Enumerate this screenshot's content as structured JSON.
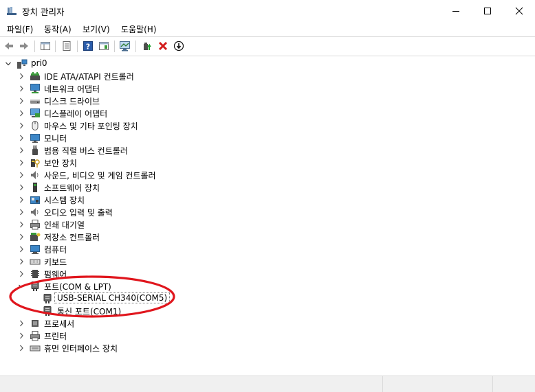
{
  "window": {
    "title": "장치 관리자"
  },
  "menu": [
    {
      "label": "파일(F)"
    },
    {
      "label": "동작(A)"
    },
    {
      "label": "보기(V)"
    },
    {
      "label": "도움말(H)"
    }
  ],
  "tree": {
    "root": {
      "label": "pri0"
    },
    "items": [
      {
        "label": "IDE ATA/ATAPI 컨트롤러",
        "icon": "ide-controller-icon"
      },
      {
        "label": "네트워크 어댑터",
        "icon": "network-adapter-icon"
      },
      {
        "label": "디스크 드라이브",
        "icon": "disk-drive-icon"
      },
      {
        "label": "디스플레이 어댑터",
        "icon": "display-adapter-icon"
      },
      {
        "label": "마우스 및 기타 포인팅 장치",
        "icon": "mouse-icon"
      },
      {
        "label": "모니터",
        "icon": "monitor-icon"
      },
      {
        "label": "범용 직렬 버스 컨트롤러",
        "icon": "usb-icon"
      },
      {
        "label": "보안 장치",
        "icon": "security-device-icon"
      },
      {
        "label": "사운드, 비디오 및 게임 컨트롤러",
        "icon": "speaker-icon"
      },
      {
        "label": "소프트웨어 장치",
        "icon": "software-device-icon"
      },
      {
        "label": "시스템 장치",
        "icon": "system-device-icon"
      },
      {
        "label": "오디오 입력 및 출력",
        "icon": "speaker-icon"
      },
      {
        "label": "인쇄 대기열",
        "icon": "printer-icon"
      },
      {
        "label": "저장소 컨트롤러",
        "icon": "storage-controller-icon"
      },
      {
        "label": "컴퓨터",
        "icon": "computer-icon"
      },
      {
        "label": "키보드",
        "icon": "keyboard-icon"
      },
      {
        "label": "펌웨어",
        "icon": "firmware-icon"
      },
      {
        "label": "포트(COM & LPT)",
        "icon": "port-icon",
        "expanded": true,
        "children": [
          {
            "label": "USB-SERIAL CH340(COM5)",
            "icon": "port-icon",
            "selected": true
          },
          {
            "label": "통신 포트(COM1)",
            "icon": "port-icon"
          }
        ]
      },
      {
        "label": "프로세서",
        "icon": "processor-icon"
      },
      {
        "label": "프린터",
        "icon": "printer-icon"
      },
      {
        "label": "휴먼 인터페이스 장치",
        "icon": "hid-icon"
      }
    ]
  },
  "colors": {
    "annotation_ellipse": "#e0161d",
    "selection_outline": "#7a7a7a"
  }
}
